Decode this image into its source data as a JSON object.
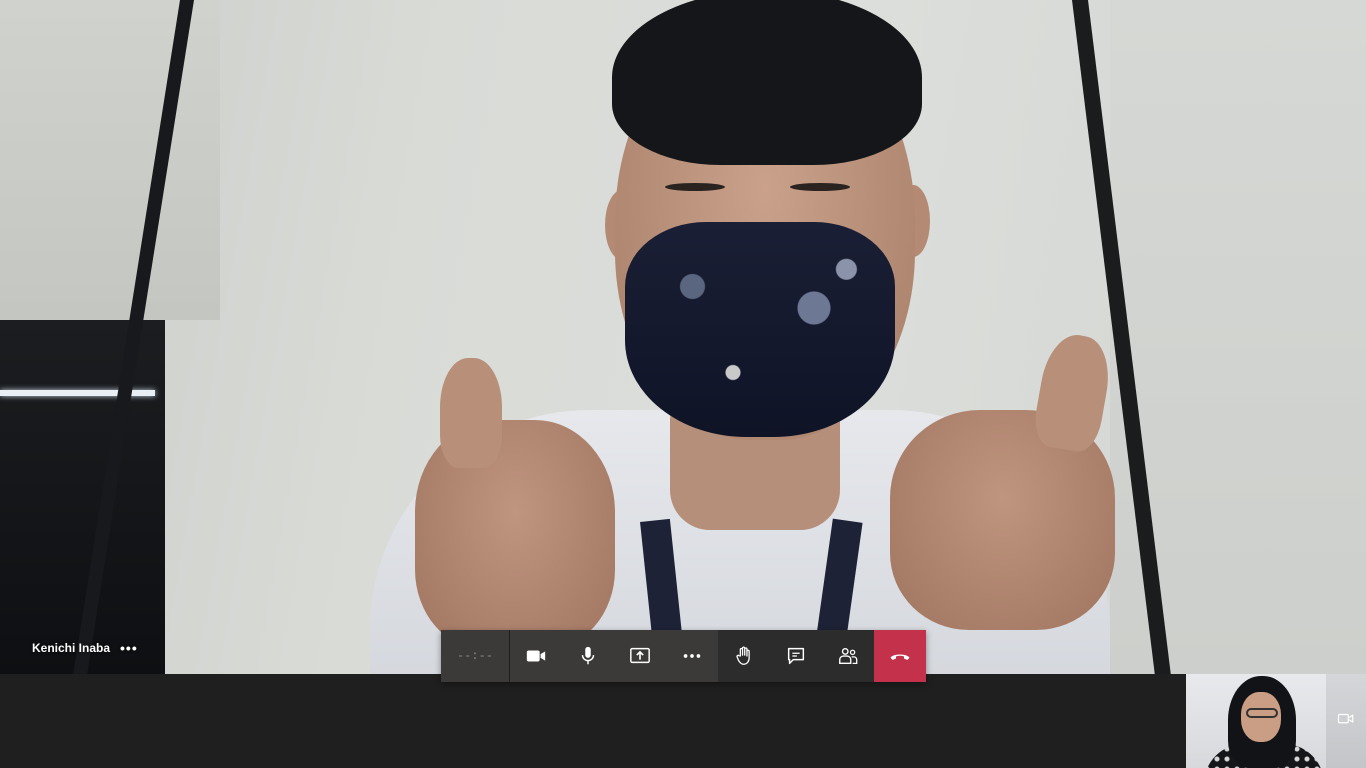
{
  "participant": {
    "name": "Kenichi Inaba",
    "more_label": "•••"
  },
  "toolbar": {
    "timer": "--:--",
    "buttons": [
      {
        "name": "camera",
        "icon": "video-camera-icon"
      },
      {
        "name": "microphone",
        "icon": "microphone-icon"
      },
      {
        "name": "share",
        "icon": "share-screen-icon"
      },
      {
        "name": "more-actions",
        "icon": "more-icon"
      },
      {
        "name": "raise-hand",
        "icon": "hand-icon"
      },
      {
        "name": "chat",
        "icon": "chat-icon"
      },
      {
        "name": "participants",
        "icon": "people-icon"
      },
      {
        "name": "hang-up",
        "icon": "phone-hangup-icon"
      }
    ],
    "hangup_color": "#c4314b"
  },
  "self_view": {
    "icon": "camera-switch-icon"
  }
}
